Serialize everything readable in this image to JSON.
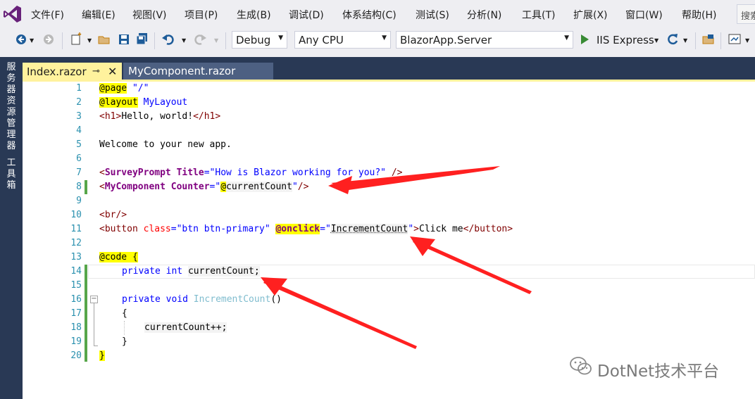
{
  "menu": {
    "items": [
      "文件(F)",
      "编辑(E)",
      "视图(V)",
      "项目(P)",
      "生成(B)",
      "调试(D)",
      "体系结构(C)",
      "测试(S)",
      "分析(N)",
      "工具(T)",
      "扩展(X)",
      "窗口(W)",
      "帮助(H)"
    ],
    "search_placeholder": "搜索"
  },
  "toolbar": {
    "configuration": "Debug",
    "platform": "Any CPU",
    "startup_project": "BlazorApp.Server",
    "run_label": "IIS Express"
  },
  "side_panels": [
    "服务器资源管理器",
    "工具箱"
  ],
  "tabs": [
    {
      "label": "Index.razor",
      "active": true
    },
    {
      "label": "MyComponent.razor",
      "active": false
    }
  ],
  "editor": {
    "line_numbers": [
      "1",
      "2",
      "3",
      "4",
      "5",
      "6",
      "7",
      "8",
      "9",
      "10",
      "11",
      "12",
      "13",
      "14",
      "15",
      "16",
      "17",
      "18",
      "19",
      "20"
    ],
    "tokens": {
      "l1_dir": "@page",
      "l1_str": "\"/\"",
      "l2_dir": "@layout",
      "l2_val": "MyLayout",
      "l3_open": "<h1>",
      "l3_text": "Hello, world!",
      "l3_close": "</h1>",
      "l5_text": "Welcome to your new app.",
      "l7_lt": "<",
      "l7_comp": "SurveyPrompt",
      "l7_attr": "Title",
      "l7_eq": "=",
      "l7_str": "\"How is Blazor working for you?\"",
      "l7_end": " />",
      "l8_lt": "<",
      "l8_comp": "MyComponent",
      "l8_attr": "Counter",
      "l8_eq": "=",
      "l8_q1": "\"",
      "l8_at": "@",
      "l8_var": "currentCount",
      "l8_q2": "\"",
      "l8_end": "/>",
      "l10_tag": "<br/>",
      "l11_lt": "<",
      "l11_tag": "button",
      "l11_attr": "class",
      "l11_eq": "=",
      "l11_str": "\"btn btn-primary\"",
      "l11_dir": "@onclick",
      "l11_eq2": "=",
      "l11_q1": "\"",
      "l11_val": "IncrementCount",
      "l11_q2": "\"",
      "l11_gt": ">",
      "l11_text": "Click me",
      "l11_close": "</button>",
      "l13_dir": "@code",
      "l13_brace": " {",
      "l14_kw1": "private",
      "l14_kw2": "int",
      "l14_var": "currentCount;",
      "l16_kw1": "private",
      "l16_kw2": "void",
      "l16_name": "IncrementCount",
      "l16_paren": "()",
      "l17": "{",
      "l18": "currentCount++;",
      "l19": "}",
      "l20": "}"
    }
  },
  "watermark": "DotNet技术平台",
  "colors": {
    "menubar_bg": "#eeeef2",
    "navy_frame": "#293955",
    "active_tab": "#fff29d",
    "inactive_tab": "#4d6082",
    "arrow_red": "#ff2020",
    "change_bar": "#57a64a"
  }
}
